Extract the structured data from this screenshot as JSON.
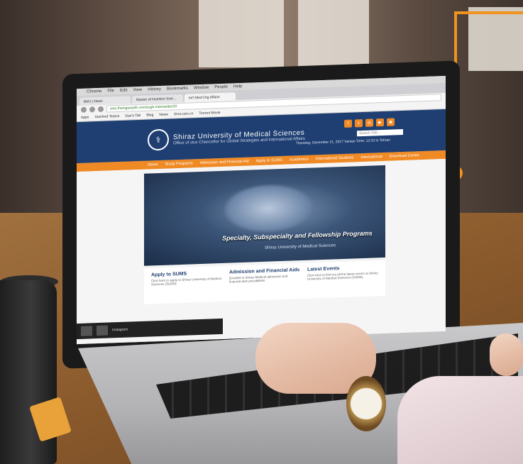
{
  "browser": {
    "menu": [
      "Chrome",
      "File",
      "Edit",
      "View",
      "History",
      "Bookmarks",
      "Window",
      "People",
      "Help"
    ],
    "tabs": [
      {
        "label": "BMJ | News"
      },
      {
        "label": "Master of Nutrition Scie..."
      },
      {
        "label": "Int'l Med Org Affairs"
      }
    ],
    "url": "sina.fhomgossafe.com/sugh-internatibn/20",
    "bookmarks": [
      "Apps",
      "Stanford Teams",
      "Dan's Tab",
      "Blog",
      "News",
      "Sina.com.cn",
      "Torrent Movie"
    ]
  },
  "site": {
    "title": "Shiraz University of Medical Sciences",
    "subtitle": "Office of vice Chancellor for Global Strategies and International Affairs",
    "date_line": "Thursday, December 21, 2017 Iranian Time: 12:33 in Tehran",
    "search_placeholder": "Search Site...",
    "nav": [
      "About",
      "Study Programs",
      "Admission and Financial Aid",
      "Apply to SUMS",
      "Academics",
      "International Students",
      "International",
      "Download Center"
    ],
    "hero": {
      "title": "Specialty, Subspecialty and Fellowship Programs",
      "subtitle": "Shiraz University of Medical Sciences"
    },
    "cards": [
      {
        "title": "Apply to SUMS",
        "text": "Click here to apply to Shiraz University of Medical Sciences (SUMS)."
      },
      {
        "title": "Admission and Financial Aids",
        "text": "Enrolled in Shiraz Medical admission and financial aids possibilities."
      },
      {
        "title": "Latest Events",
        "text": "Click here to find out all the latest events at Shiraz University of Medical Sciences (SUMS)."
      }
    ],
    "taskbar_item": "Instagram"
  },
  "colors": {
    "header_blue": "#1f3f72",
    "accent_orange": "#f08a24",
    "frame_orange": "#f0931f"
  },
  "icons": {
    "logo": "university-logo-icon",
    "social": [
      "facebook-icon",
      "twitter-icon",
      "instagram-icon",
      "youtube-icon",
      "rss-icon"
    ]
  }
}
